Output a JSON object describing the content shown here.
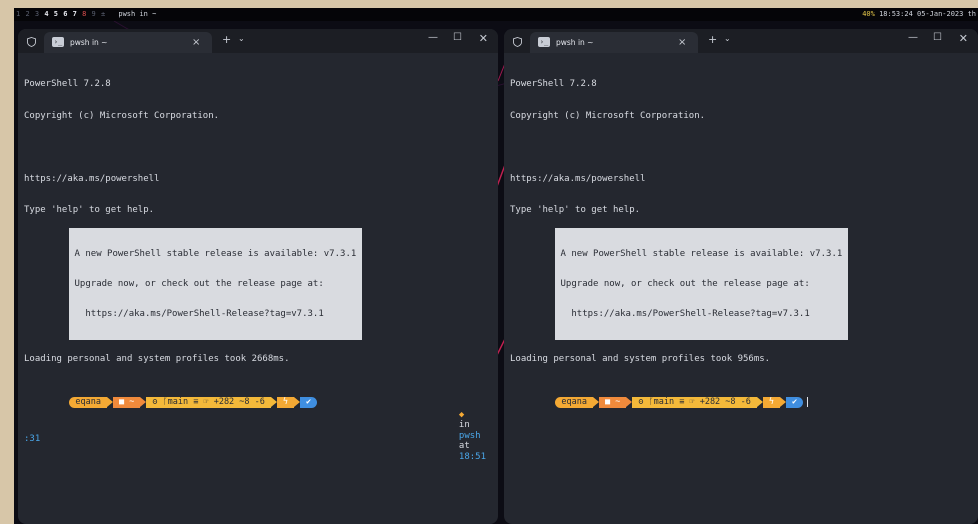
{
  "topbar": {
    "workspaces": [
      "1",
      "2",
      "3",
      "4",
      "5",
      "6",
      "7",
      "8",
      "9",
      "±"
    ],
    "window_title": "pwsh in ~",
    "battery": "40%",
    "clock": "18:53:24 05-Jan-2023 th"
  },
  "windows": [
    {
      "tab_title": "pwsh in ~",
      "tab_close": "×",
      "new_tab": "+",
      "dropdown": "⌄",
      "lines": [
        "PowerShell 7.2.8",
        "Copyright (c) Microsoft Corporation.",
        "",
        "https://aka.ms/powershell",
        "Type 'help' to get help."
      ],
      "notice": [
        "A new PowerShell stable release is available: v7.3.1",
        "Upgrade now, or check out the release page at:",
        "  https://aka.ms/PowerShell-Release?tag=v7.3.1"
      ],
      "loading": "Loading personal and system profiles took 2668ms.",
      "prompt": {
        "user": "eqana",
        "path": "■ ~",
        "git": "ʘ ᚴmain ≡ ☞ +282 ~8 -6",
        "exec": "ϟ",
        "status": "✔"
      },
      "rprompt": {
        "diamond": "◆",
        "in": "in",
        "shell": "pwsh",
        "at": "at",
        "time": "18:51",
        "wrap": ":31"
      }
    },
    {
      "tab_title": "pwsh in ~",
      "tab_close": "×",
      "new_tab": "+",
      "dropdown": "⌄",
      "lines": [
        "PowerShell 7.2.8",
        "Copyright (c) Microsoft Corporation.",
        "",
        "https://aka.ms/powershell",
        "Type 'help' to get help."
      ],
      "notice": [
        "A new PowerShell stable release is available: v7.3.1",
        "Upgrade now, or check out the release page at:",
        "  https://aka.ms/PowerShell-Release?tag=v7.3.1"
      ],
      "loading": "Loading personal and system profiles took 956ms.",
      "prompt": {
        "user": "eqana",
        "path": "■ ~",
        "git": "ʘ ᚴmain ≡ ☞ +282 ~8 -6",
        "exec": "ϟ",
        "status": "✔"
      }
    }
  ],
  "controls": {
    "minimize": "—",
    "maximize": "☐",
    "close": "✕"
  },
  "colors": {
    "terminal_bg": "#24272f",
    "accent_orange": "#f4a934",
    "accent_blue": "#3f8ee0",
    "notice_bg": "#d9dbe0"
  }
}
